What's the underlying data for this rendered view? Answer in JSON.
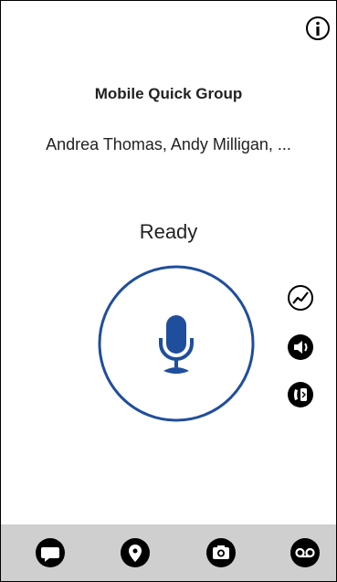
{
  "header": {
    "info_icon": "info-icon"
  },
  "group": {
    "title": "Mobile Quick Group",
    "members": "Andrea Thomas, Andy Milligan, ..."
  },
  "call": {
    "status": "Ready",
    "ptt_icon": "microphone-icon"
  },
  "side_controls": [
    {
      "icon": "signal-icon"
    },
    {
      "icon": "speaker-icon"
    },
    {
      "icon": "bluetooth-phone-icon"
    }
  ],
  "bottom_nav": [
    {
      "icon": "message-icon"
    },
    {
      "icon": "location-icon"
    },
    {
      "icon": "camera-icon"
    },
    {
      "icon": "voicemail-icon"
    }
  ],
  "colors": {
    "accent": "#1f4e9c",
    "bottom_bar": "#cfcfcf",
    "text": "#222222",
    "icon": "#000000"
  }
}
